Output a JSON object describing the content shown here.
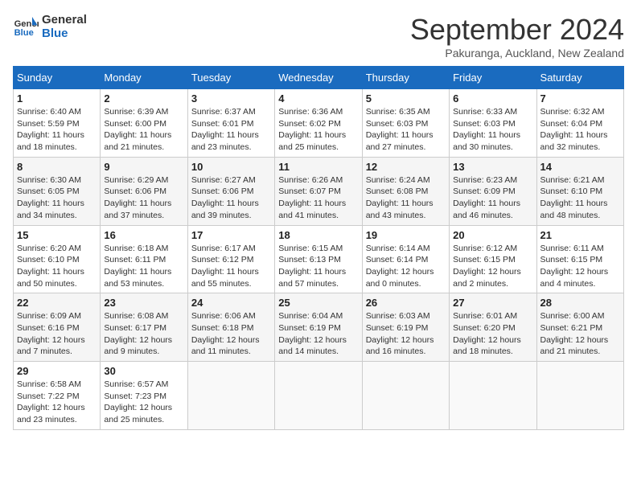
{
  "header": {
    "logo_general": "General",
    "logo_blue": "Blue",
    "month_title": "September 2024",
    "subtitle": "Pakuranga, Auckland, New Zealand"
  },
  "days_of_week": [
    "Sunday",
    "Monday",
    "Tuesday",
    "Wednesday",
    "Thursday",
    "Friday",
    "Saturday"
  ],
  "weeks": [
    [
      {
        "day": "1",
        "sunrise": "6:40 AM",
        "sunset": "5:59 PM",
        "daylight": "11 hours and 18 minutes."
      },
      {
        "day": "2",
        "sunrise": "6:39 AM",
        "sunset": "6:00 PM",
        "daylight": "11 hours and 21 minutes."
      },
      {
        "day": "3",
        "sunrise": "6:37 AM",
        "sunset": "6:01 PM",
        "daylight": "11 hours and 23 minutes."
      },
      {
        "day": "4",
        "sunrise": "6:36 AM",
        "sunset": "6:02 PM",
        "daylight": "11 hours and 25 minutes."
      },
      {
        "day": "5",
        "sunrise": "6:35 AM",
        "sunset": "6:03 PM",
        "daylight": "11 hours and 27 minutes."
      },
      {
        "day": "6",
        "sunrise": "6:33 AM",
        "sunset": "6:03 PM",
        "daylight": "11 hours and 30 minutes."
      },
      {
        "day": "7",
        "sunrise": "6:32 AM",
        "sunset": "6:04 PM",
        "daylight": "11 hours and 32 minutes."
      }
    ],
    [
      {
        "day": "8",
        "sunrise": "6:30 AM",
        "sunset": "6:05 PM",
        "daylight": "11 hours and 34 minutes."
      },
      {
        "day": "9",
        "sunrise": "6:29 AM",
        "sunset": "6:06 PM",
        "daylight": "11 hours and 37 minutes."
      },
      {
        "day": "10",
        "sunrise": "6:27 AM",
        "sunset": "6:06 PM",
        "daylight": "11 hours and 39 minutes."
      },
      {
        "day": "11",
        "sunrise": "6:26 AM",
        "sunset": "6:07 PM",
        "daylight": "11 hours and 41 minutes."
      },
      {
        "day": "12",
        "sunrise": "6:24 AM",
        "sunset": "6:08 PM",
        "daylight": "11 hours and 43 minutes."
      },
      {
        "day": "13",
        "sunrise": "6:23 AM",
        "sunset": "6:09 PM",
        "daylight": "11 hours and 46 minutes."
      },
      {
        "day": "14",
        "sunrise": "6:21 AM",
        "sunset": "6:10 PM",
        "daylight": "11 hours and 48 minutes."
      }
    ],
    [
      {
        "day": "15",
        "sunrise": "6:20 AM",
        "sunset": "6:10 PM",
        "daylight": "11 hours and 50 minutes."
      },
      {
        "day": "16",
        "sunrise": "6:18 AM",
        "sunset": "6:11 PM",
        "daylight": "11 hours and 53 minutes."
      },
      {
        "day": "17",
        "sunrise": "6:17 AM",
        "sunset": "6:12 PM",
        "daylight": "11 hours and 55 minutes."
      },
      {
        "day": "18",
        "sunrise": "6:15 AM",
        "sunset": "6:13 PM",
        "daylight": "11 hours and 57 minutes."
      },
      {
        "day": "19",
        "sunrise": "6:14 AM",
        "sunset": "6:14 PM",
        "daylight": "12 hours and 0 minutes."
      },
      {
        "day": "20",
        "sunrise": "6:12 AM",
        "sunset": "6:15 PM",
        "daylight": "12 hours and 2 minutes."
      },
      {
        "day": "21",
        "sunrise": "6:11 AM",
        "sunset": "6:15 PM",
        "daylight": "12 hours and 4 minutes."
      }
    ],
    [
      {
        "day": "22",
        "sunrise": "6:09 AM",
        "sunset": "6:16 PM",
        "daylight": "12 hours and 7 minutes."
      },
      {
        "day": "23",
        "sunrise": "6:08 AM",
        "sunset": "6:17 PM",
        "daylight": "12 hours and 9 minutes."
      },
      {
        "day": "24",
        "sunrise": "6:06 AM",
        "sunset": "6:18 PM",
        "daylight": "12 hours and 11 minutes."
      },
      {
        "day": "25",
        "sunrise": "6:04 AM",
        "sunset": "6:19 PM",
        "daylight": "12 hours and 14 minutes."
      },
      {
        "day": "26",
        "sunrise": "6:03 AM",
        "sunset": "6:19 PM",
        "daylight": "12 hours and 16 minutes."
      },
      {
        "day": "27",
        "sunrise": "6:01 AM",
        "sunset": "6:20 PM",
        "daylight": "12 hours and 18 minutes."
      },
      {
        "day": "28",
        "sunrise": "6:00 AM",
        "sunset": "6:21 PM",
        "daylight": "12 hours and 21 minutes."
      }
    ],
    [
      {
        "day": "29",
        "sunrise": "6:58 AM",
        "sunset": "7:22 PM",
        "daylight": "12 hours and 23 minutes."
      },
      {
        "day": "30",
        "sunrise": "6:57 AM",
        "sunset": "7:23 PM",
        "daylight": "12 hours and 25 minutes."
      },
      null,
      null,
      null,
      null,
      null
    ]
  ],
  "labels": {
    "sunrise": "Sunrise: ",
    "sunset": "Sunset: ",
    "daylight": "Daylight: "
  }
}
